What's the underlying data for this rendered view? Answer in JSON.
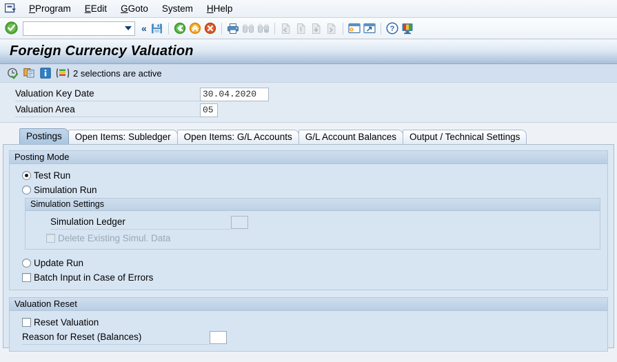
{
  "menubar": {
    "system_icon": "sap-session-icon",
    "items": [
      {
        "label": "Program",
        "accel": "P"
      },
      {
        "label": "Edit",
        "accel": "E"
      },
      {
        "label": "Goto",
        "accel": "G"
      },
      {
        "label": "System",
        "accel": "y"
      },
      {
        "label": "Help",
        "accel": "H"
      }
    ]
  },
  "toolbar": {
    "enter_icon": "green-check-icon",
    "command_field_value": "",
    "command_field_placeholder": "",
    "dropdown_icon": "chevron-down-icon",
    "more_icon": "double-chevron-left-icon",
    "buttons": [
      {
        "name": "save-button",
        "icon": "save-floppy-icon",
        "enabled": true
      },
      {
        "name": "back-button",
        "icon": "green-back-arrow-icon",
        "enabled": true
      },
      {
        "name": "exit-button",
        "icon": "orange-up-arrow-icon",
        "enabled": true
      },
      {
        "name": "cancel-button",
        "icon": "red-cancel-icon",
        "enabled": true
      },
      {
        "name": "print-button",
        "icon": "printer-icon",
        "enabled": true
      },
      {
        "name": "find-button",
        "icon": "binoculars-icon",
        "enabled": false
      },
      {
        "name": "find-next-button",
        "icon": "binoculars-plus-icon",
        "enabled": false
      },
      {
        "name": "first-page-button",
        "icon": "first-page-icon",
        "enabled": false
      },
      {
        "name": "previous-page-button",
        "icon": "previous-page-icon",
        "enabled": false
      },
      {
        "name": "next-page-button",
        "icon": "next-page-icon",
        "enabled": false
      },
      {
        "name": "last-page-button",
        "icon": "last-page-icon",
        "enabled": false
      },
      {
        "name": "create-session-button",
        "icon": "new-session-icon",
        "enabled": true
      },
      {
        "name": "create-shortcut-button",
        "icon": "shortcut-icon",
        "enabled": true
      },
      {
        "name": "help-button",
        "icon": "question-mark-icon",
        "enabled": true
      },
      {
        "name": "customize-layout-button",
        "icon": "monitor-icon",
        "enabled": true
      }
    ]
  },
  "header": {
    "title": "Foreign Currency Valuation"
  },
  "selection_bar": {
    "execute_icon": "execute-clock-check-icon",
    "variant_icon": "get-variant-icon",
    "info_icon": "information-icon",
    "selections_icon": "selection-options-icon",
    "status_text": "2 selections are active"
  },
  "selection_fields": [
    {
      "label": "Valuation Key Date",
      "value": "30.04.2020",
      "name": "valuation-key-date"
    },
    {
      "label": "Valuation Area",
      "value": "05",
      "name": "valuation-area"
    }
  ],
  "tabs": [
    {
      "label": "Postings",
      "selected": true
    },
    {
      "label": "Open Items: Subledger",
      "selected": false
    },
    {
      "label": "Open Items: G/L Accounts",
      "selected": false
    },
    {
      "label": "G/L Account Balances",
      "selected": false
    },
    {
      "label": "Output / Technical Settings",
      "selected": false
    }
  ],
  "posting_mode": {
    "group_title": "Posting Mode",
    "test_run": {
      "label": "Test Run",
      "checked": true
    },
    "simulation_run": {
      "label": "Simulation Run",
      "checked": false
    },
    "simulation_settings": {
      "group_title": "Simulation Settings",
      "simulation_ledger": {
        "label": "Simulation Ledger",
        "value": "",
        "disabled": true
      },
      "delete_existing": {
        "label": "Delete Existing Simul. Data",
        "checked": false,
        "disabled": true
      }
    },
    "update_run": {
      "label": "Update Run",
      "checked": false
    },
    "batch_input": {
      "label": "Batch Input in Case of Errors",
      "checked": false
    }
  },
  "valuation_reset": {
    "group_title": "Valuation Reset",
    "reset_valuation": {
      "label": "Reset Valuation",
      "checked": false
    },
    "reason_for_reset": {
      "label": "Reason for Reset (Balances)",
      "value": "",
      "disabled": false
    }
  },
  "colors": {
    "page_background": "#eef2f7",
    "panel_background": "#dce8f4",
    "group_background": "#d7e5f3",
    "selected_tab": "#aac6e0",
    "accent_blue": "#1d4f91"
  }
}
